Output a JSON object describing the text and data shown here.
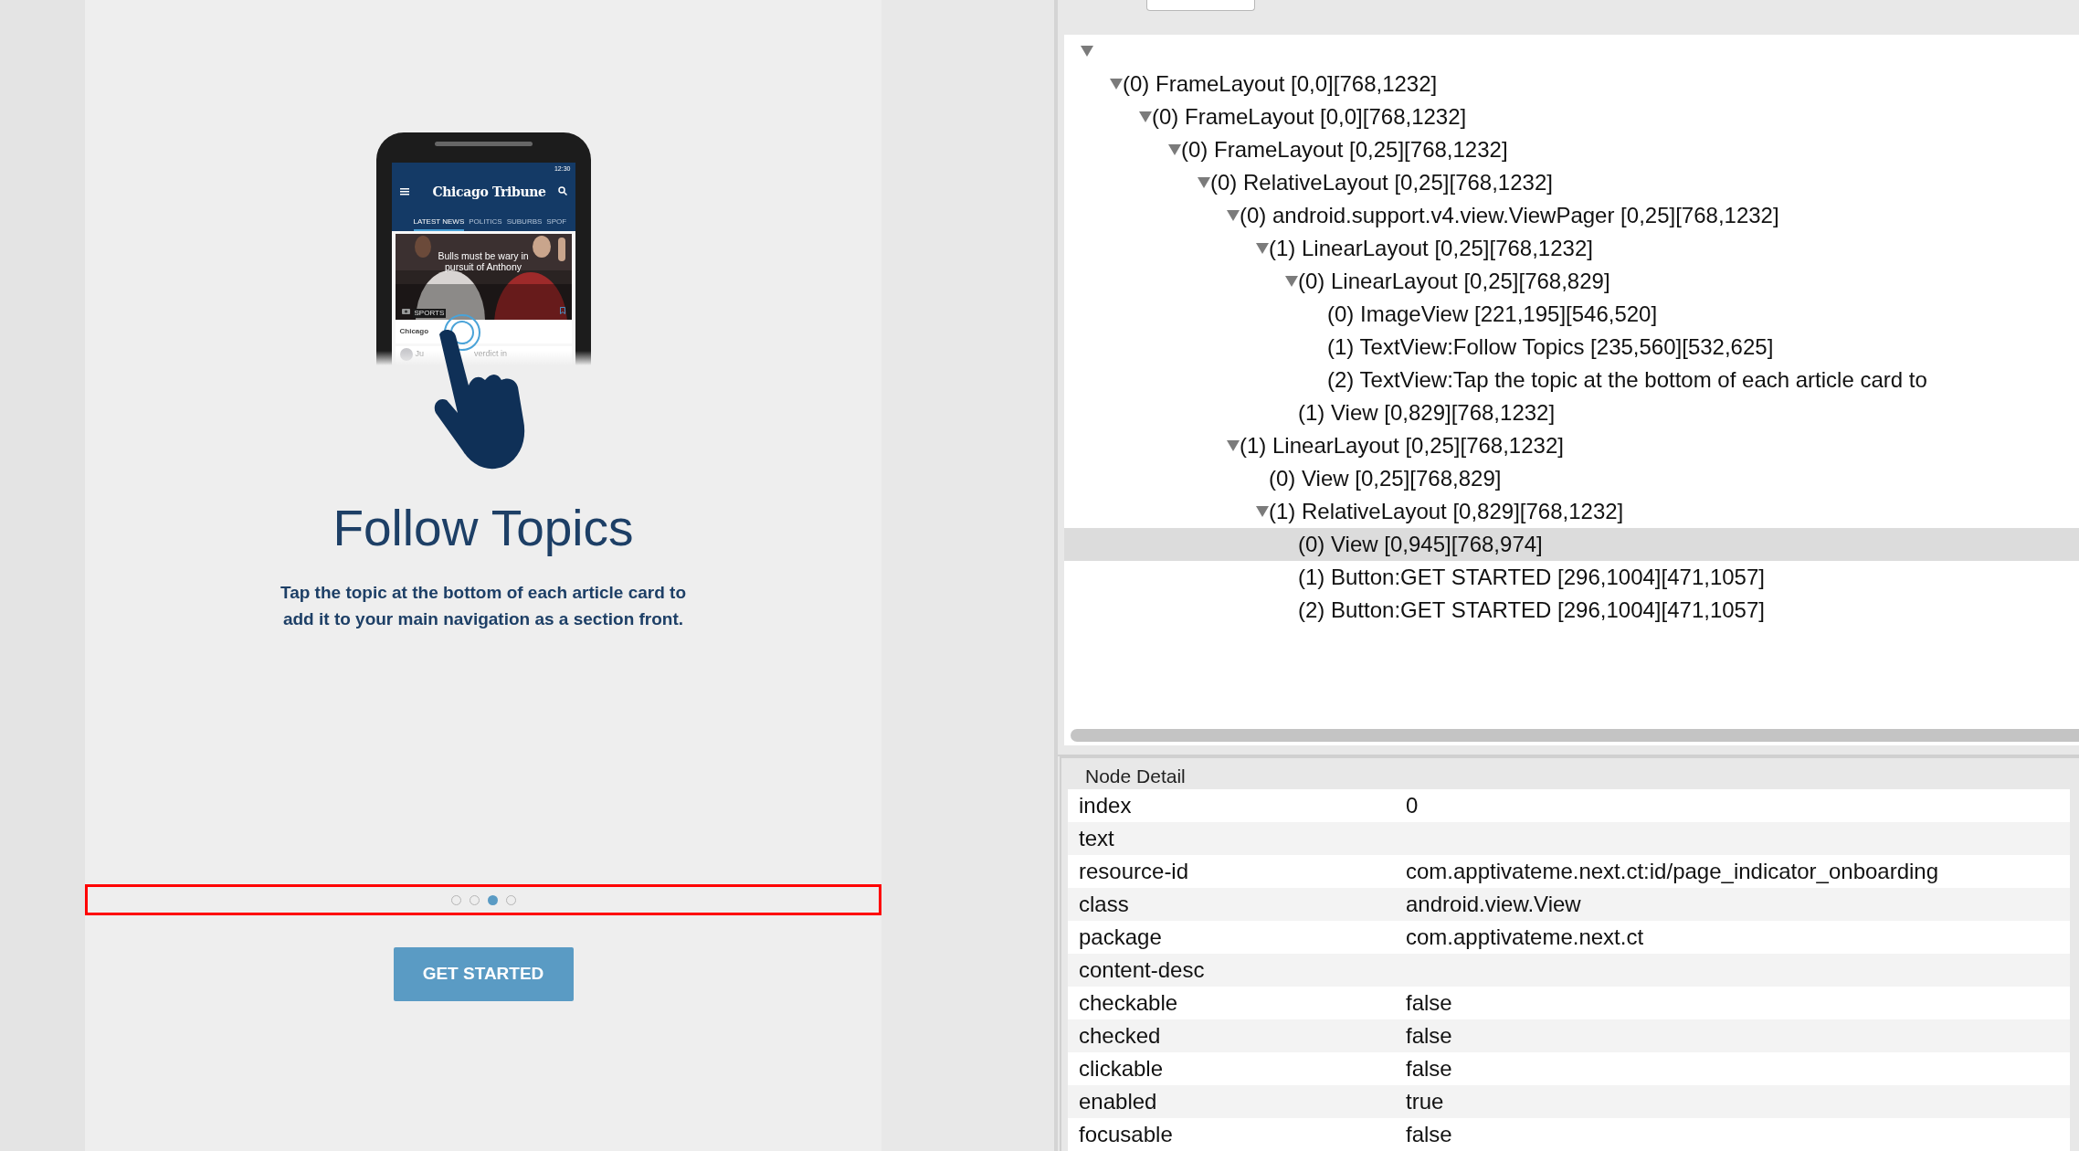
{
  "device_screen": {
    "phone_illustration": {
      "status_time": "12:30",
      "app_logo": "Chicago Tribune",
      "tabs": [
        {
          "label": "LATEST NEWS",
          "selected": true
        },
        {
          "label": "POLITICS",
          "selected": false
        },
        {
          "label": "SUBURBS",
          "selected": false
        },
        {
          "label": "SPOF",
          "selected": false
        }
      ],
      "headline": "Bulls must be wary in pursuit of Anthony",
      "card_section": "SPORTS",
      "topic_label": "Chicago",
      "next_item_start": "Ju",
      "next_item_end": "verdict in"
    },
    "title": "Follow Topics",
    "description": [
      "Tap the topic at the bottom of each article card to",
      "add it to your main navigation as a section front."
    ],
    "page_indicator": [
      {
        "selected": false
      },
      {
        "selected": false
      },
      {
        "selected": true
      },
      {
        "selected": false
      }
    ],
    "button": "GET STARTED"
  },
  "hierarchy": {
    "root": {
      "expanded": true,
      "selected": false,
      "children": [
        {
          "label": "(0) FrameLayout [0,0][768,1232]",
          "expanded": true,
          "selected": false,
          "children": [
            {
              "label": "(0) FrameLayout [0,0][768,1232]",
              "expanded": true,
              "selected": false,
              "children": [
                {
                  "label": "(0) FrameLayout [0,25][768,1232]",
                  "expanded": true,
                  "selected": false,
                  "children": [
                    {
                      "label": "(0) RelativeLayout [0,25][768,1232]",
                      "expanded": true,
                      "selected": false,
                      "children": [
                        {
                          "label": "(0) android.support.v4.view.ViewPager [0,25][768,1232]",
                          "expanded": true,
                          "selected": false,
                          "children": [
                            {
                              "label": "(1) LinearLayout [0,25][768,1232]",
                              "expanded": true,
                              "selected": false,
                              "children": [
                                {
                                  "label": "(0) LinearLayout [0,25][768,829]",
                                  "expanded": true,
                                  "selected": false,
                                  "children": [
                                    {
                                      "label": "(0) ImageView [221,195][546,520]",
                                      "selected": false
                                    },
                                    {
                                      "label": "(1) TextView:Follow Topics [235,560][532,625]",
                                      "selected": false
                                    },
                                    {
                                      "label": "(2) TextView:Tap the topic at the bottom of each article card to",
                                      "selected": false
                                    }
                                  ]
                                },
                                {
                                  "label": "(1) View [0,829][768,1232]",
                                  "selected": false
                                }
                              ]
                            }
                          ]
                        },
                        {
                          "label": "(1) LinearLayout [0,25][768,1232]",
                          "expanded": true,
                          "selected": false,
                          "children": [
                            {
                              "label": "(0) View [0,25][768,829]",
                              "selected": false
                            },
                            {
                              "label": "(1) RelativeLayout [0,829][768,1232]",
                              "expanded": true,
                              "selected": false,
                              "children": [
                                {
                                  "label": "(0) View [0,945][768,974]",
                                  "selected": true
                                },
                                {
                                  "label": "(1) Button:GET STARTED [296,1004][471,1057]",
                                  "selected": false
                                },
                                {
                                  "label": "(2) Button:GET STARTED [296,1004][471,1057]",
                                  "selected": false
                                }
                              ]
                            }
                          ]
                        }
                      ]
                    }
                  ]
                }
              ]
            }
          ]
        }
      ]
    }
  },
  "node_detail": {
    "title": "Node Detail",
    "rows": [
      {
        "key": "index",
        "value": "0"
      },
      {
        "key": "text"
      },
      {
        "key": "resource-id",
        "value": "com.apptivateme.next.ct:id/page_indicator_onboarding"
      },
      {
        "key": "class",
        "value": "android.view.View"
      },
      {
        "key": "package",
        "value": "com.apptivateme.next.ct"
      },
      {
        "key": "content-desc"
      },
      {
        "key": "checkable",
        "value": "false"
      },
      {
        "key": "checked",
        "value": "false"
      },
      {
        "key": "clickable",
        "value": "false"
      },
      {
        "key": "enabled",
        "value": "true"
      },
      {
        "key": "focusable",
        "value": "false"
      }
    ]
  }
}
